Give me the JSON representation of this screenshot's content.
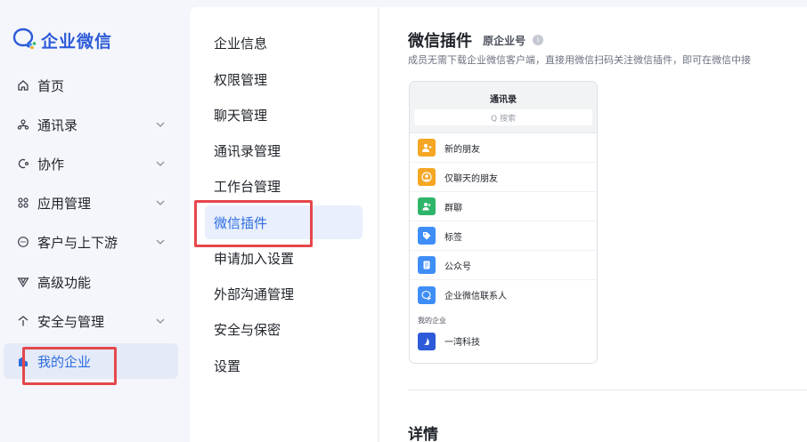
{
  "app": {
    "logo_text": "企业微信",
    "brand_color": "#2c5ad8",
    "accent": "#2d6cdf",
    "highlight": "#e5474b"
  },
  "sidebar": {
    "items": [
      {
        "label": "首页",
        "icon": "home-icon",
        "has_chevron": false
      },
      {
        "label": "通讯录",
        "icon": "org-chart-icon",
        "has_chevron": true
      },
      {
        "label": "协作",
        "icon": "collaboration-icon",
        "has_chevron": true
      },
      {
        "label": "应用管理",
        "icon": "apps-grid-icon",
        "has_chevron": true
      },
      {
        "label": "客户与上下游",
        "icon": "chat-bubble-icon",
        "has_chevron": true
      },
      {
        "label": "高级功能",
        "icon": "v-badge-icon",
        "has_chevron": false
      },
      {
        "label": "安全与管理",
        "icon": "shield-icon",
        "has_chevron": true
      },
      {
        "label": "我的企业",
        "icon": "building-icon",
        "has_chevron": false,
        "active": true
      }
    ]
  },
  "submenu": {
    "items": [
      {
        "label": "企业信息"
      },
      {
        "label": "权限管理"
      },
      {
        "label": "聊天管理"
      },
      {
        "label": "通讯录管理"
      },
      {
        "label": "工作台管理"
      },
      {
        "label": "微信插件",
        "active": true
      },
      {
        "label": "申请加入设置"
      },
      {
        "label": "外部沟通管理"
      },
      {
        "label": "安全与保密"
      },
      {
        "label": "设置"
      }
    ]
  },
  "main": {
    "title": "微信插件",
    "subtitle": "原企业号",
    "description": "成员无需下载企业微信客户端，直接用微信扫码关注微信插件，即可在微信中接",
    "phone": {
      "title": "通讯录",
      "search_placeholder": "Q 搜索",
      "contacts": [
        {
          "label": "新的朋友",
          "icon": "add-friend-icon",
          "color": "#f5a623"
        },
        {
          "label": "仅聊天的朋友",
          "icon": "chat-friend-icon",
          "color": "#f5a623"
        },
        {
          "label": "群聊",
          "icon": "group-chat-icon",
          "color": "#2fb56a"
        },
        {
          "label": "标签",
          "icon": "tag-icon",
          "color": "#3f8ef7"
        },
        {
          "label": "公众号",
          "icon": "official-account-icon",
          "color": "#3f8ef7"
        },
        {
          "label": "企业微信联系人",
          "icon": "wecom-contact-icon",
          "color": "#3f8ef7"
        }
      ],
      "section_label": "我的企业",
      "company": {
        "label": "一湾科技",
        "icon": "company-logo-icon",
        "color": "#2c5ad8"
      }
    },
    "details_heading": "详情"
  }
}
